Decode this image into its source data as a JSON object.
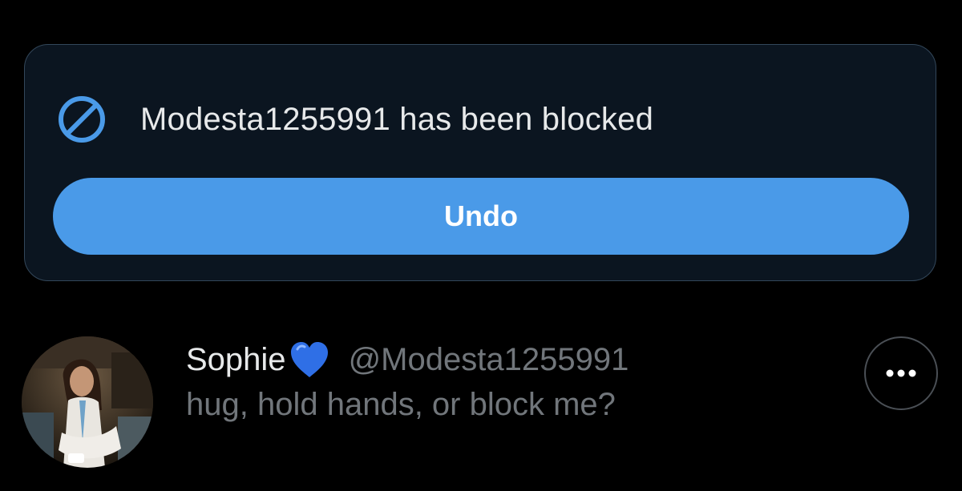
{
  "block_notice": {
    "message": "Modesta1255991 has been blocked",
    "icon": "block-icon",
    "undo_label": "Undo"
  },
  "tweet": {
    "display_name": "Sophie",
    "name_emoji": "blue-heart-icon",
    "handle": "@Modesta1255991",
    "text": "hug, hold hands, or block me?",
    "more_icon": "more-icon"
  },
  "colors": {
    "background": "#000000",
    "card": "#0b1520",
    "accent": "#4a9ae8",
    "primary_text": "#e7e9ea",
    "secondary_text": "#71767b"
  }
}
